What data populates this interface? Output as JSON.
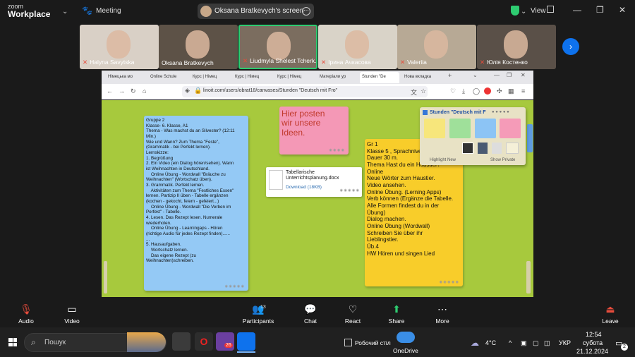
{
  "zoom": {
    "logo_small": "zoom",
    "logo_big": "Workplace",
    "meeting_label": "Meeting",
    "share_label": "Oksana Bratkevych's screen",
    "view_label": "View"
  },
  "participants": [
    {
      "name": "Halyna Savytska",
      "muted": true,
      "bg": "#d9d0c6"
    },
    {
      "name": "Oksana Bratkevych",
      "muted": false,
      "bg": "#5d5247"
    },
    {
      "name": "Liudmyla Shelest Tcherk...",
      "muted": true,
      "bg": "#7b6d5f",
      "active": true
    },
    {
      "name": "Ірина Ачкасова",
      "muted": true,
      "bg": "#d9d3c8"
    },
    {
      "name": "Valeriia",
      "muted": true,
      "bg": "#b7a995"
    },
    {
      "name": "Юлія Костенко",
      "muted": true,
      "bg": "#5a5048"
    }
  ],
  "browser": {
    "tabs": [
      "Німецька мо",
      "Online Schule",
      "Курс | Німец",
      "Курс | Німец",
      "Курс | Німец",
      "Матеріали ур",
      "Stunden \"De",
      "Нова вкладка"
    ],
    "active_tab": 6,
    "url": "linoit.com/users/obrat18/canvases/Stunden \"Deutsch mit Fro\""
  },
  "canvas": {
    "note_blue": "Gruppe 2\nKlasse- 6. Klasse, A1\nThema - Was machst du an Silvester? (12:11\nMin.)\nWie und Wann? Zum Thema \"Feste\",\n(Grammatik - bei Perfekt lernen).\nLernskizze:\n1. Begrüßung\n2. Ein Video (ein Dialog hören/sehen). Wann\nist Weihnachten in Deutschland.\n    Online Übung - Wordwall \"Bräuche zu\nWeihnachten\" (Wortschatz üben).\n3. Grammatik. Perfekt lernen.\n    Aktivitäten zum Thema \"Festliches Essen\"\nlernen. Partizip II üben - Tabelle ergänzen\n(kochen - gekocht, feiern - gefeiert...)\n    Online Übung - Wordwall \"Die Verben im\nPerfekt\" - Tabelle.\n4. Lesen. Das Rezept lesen. Numerale\nwiederholen.\n    Online Übung - Learningaps - Hören\n(richtige Audio für jedes Rezept finden)......\n...\n5. Hausaufgaben.\n    Wortschatz lernen.\n    Das eigene Rezept (zu\nWeihnachten)schreiben.",
    "note_pink": "Hier posten\nwir unsere\nIdeen.",
    "file_name": "Tabellarische\nUnterrichtsplanung.docx",
    "file_download": "Download (18KB)",
    "note_yellow": "Gr 1\nKlasse 5 , Sprachniveau 1.1\nDauer 30 m.\nThema Hast du ein Haustier?\nOnline\nNeue Wörter zum Haustier.\nVideo ansehen.\nOnline Übung. (Lerning Apps)\nVerb können (Ergänze die Tabelle.\nAlle Formen findest du in der\nÜbung)\nDialog machen.\nOnline Übung (Wordwall)\nSchreiben Sie über ihr\nLieblingstier.\nÜb.4\nHW Hören und singen Lied",
    "palette_title": "Stunden \"Deutsch mit F",
    "palette_highlight": "Highlight New",
    "palette_private": "Show Private",
    "swatch_colors": [
      "#f7e67b",
      "#9fe09a",
      "#8cc4f5",
      "#f59bb8"
    ]
  },
  "controls": [
    {
      "label": "Audio",
      "icon": "🎙"
    },
    {
      "label": "Video",
      "icon": "▭"
    },
    {
      "label": "Participants",
      "icon": "👥",
      "badge": "13"
    },
    {
      "label": "Chat",
      "icon": "💬"
    },
    {
      "label": "React",
      "icon": "♡"
    },
    {
      "label": "Share",
      "icon": "⬆"
    },
    {
      "label": "More",
      "icon": "⋯"
    },
    {
      "label": "Leave",
      "icon": "⏏"
    }
  ],
  "taskbar": {
    "search": "Пошук",
    "desktop_label": "Робочий стіл",
    "onedrive_label": "OneDrive",
    "temperature": "4°C",
    "language": "УКР",
    "time": "12:54",
    "day": "субота",
    "date": "21.12.2024",
    "notif_count": "2",
    "app_badge": "26"
  }
}
